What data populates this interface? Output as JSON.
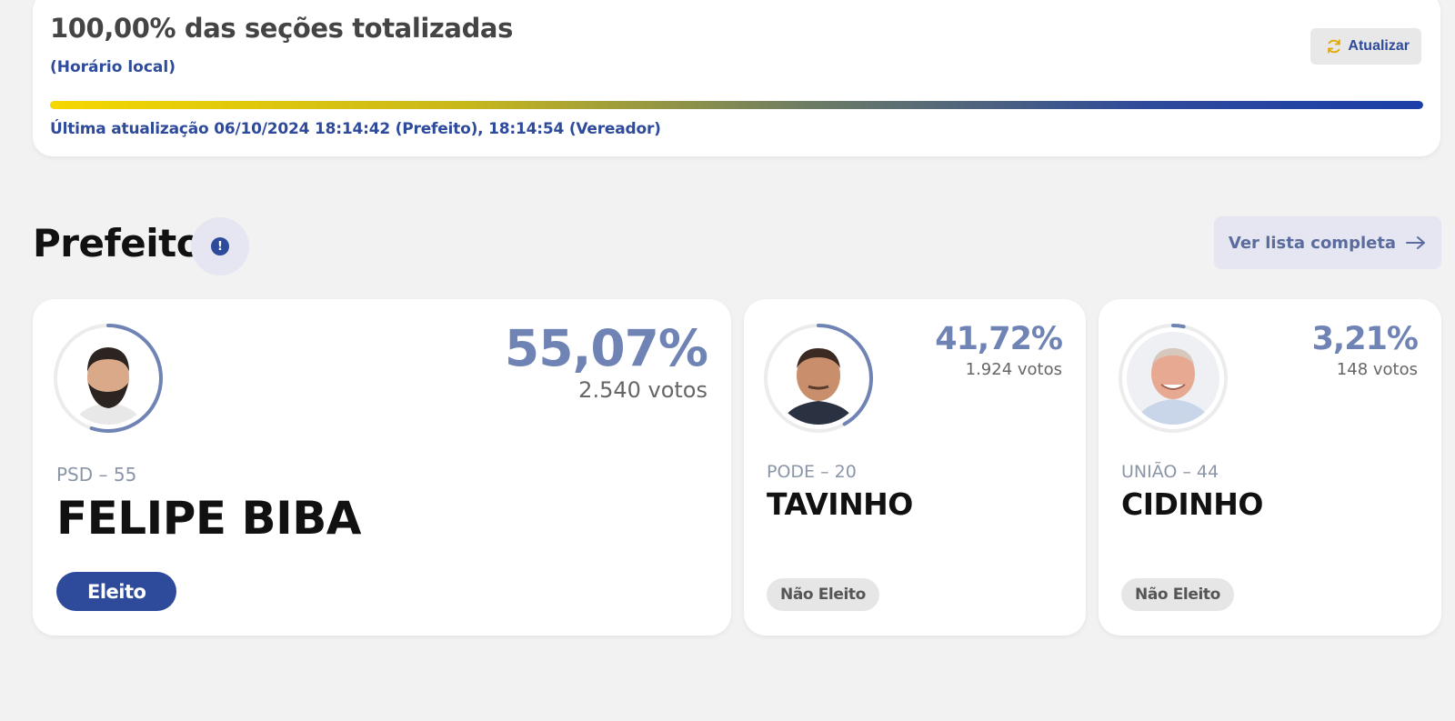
{
  "status": {
    "title": "100,00% das seções totalizadas",
    "local_time": "(Horário local)",
    "refresh_label": "Atualizar",
    "progress_fraction": 1.0,
    "last_update": "Última atualização 06/10/2024 18:14:42 (Prefeito), 18:14:54 (Vereador)"
  },
  "section": {
    "title": "Prefeito",
    "info_icon_glyph": "!",
    "full_list_label": "Ver lista completa"
  },
  "candidates": [
    {
      "percent": "55,07%",
      "votes": "2.540 votos",
      "party": "PSD – 55",
      "name": "FELIPE BIBA",
      "status": "Eleito",
      "vote_share": 0.5507
    },
    {
      "percent": "41,72%",
      "votes": "1.924 votos",
      "party": "PODE – 20",
      "name": "TAVINHO",
      "status": "Não Eleito",
      "vote_share": 0.4172
    },
    {
      "percent": "3,21%",
      "votes": "148 votos",
      "party": "UNIÃO – 44",
      "name": "CIDINHO",
      "status": "Não Eleito",
      "vote_share": 0.0321
    }
  ],
  "colors": {
    "accent": "#2e4a9a",
    "percent": "#6f84b4",
    "ring": "#6f84b4",
    "ring_track": "#ececec",
    "refresh_icon": "#e0a800"
  }
}
